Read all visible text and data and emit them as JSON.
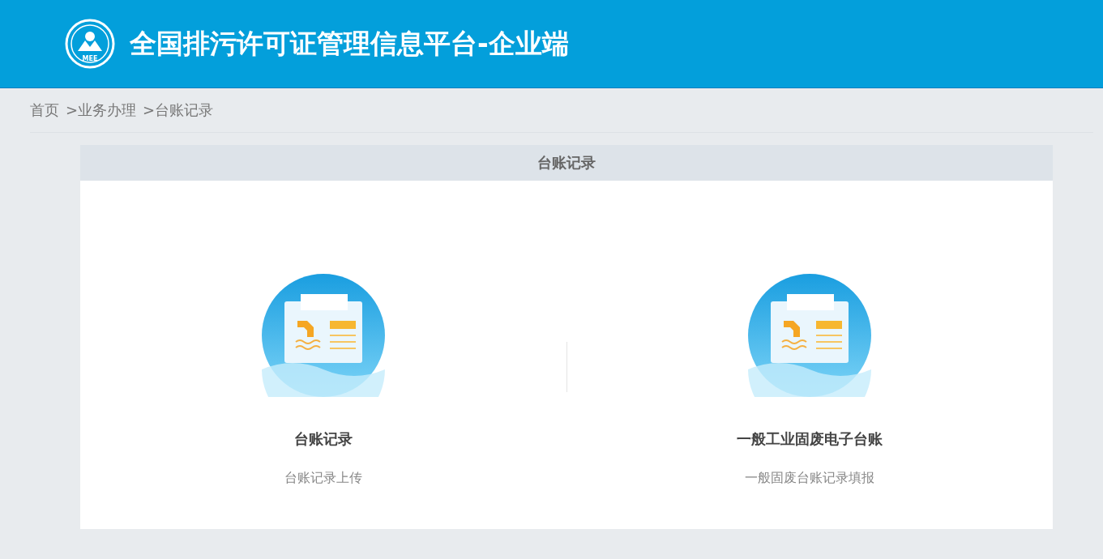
{
  "header": {
    "logo_text": "MEE",
    "title": "全国排污许可证管理信息平台-企业端"
  },
  "breadcrumb": [
    "首页",
    ">业务办理",
    ">台账记录"
  ],
  "panel": {
    "title": "台账记录",
    "cards": [
      {
        "title": "台账记录",
        "subtitle": "台账记录上传"
      },
      {
        "title": "一般工业固废电子台账",
        "subtitle": "一般固废台账记录填报"
      }
    ]
  }
}
